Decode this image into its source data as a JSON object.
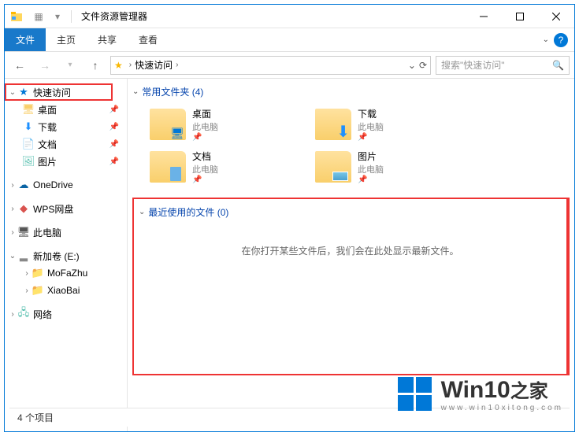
{
  "title": "文件资源管理器",
  "ribbon": {
    "file": "文件",
    "home": "主页",
    "share": "共享",
    "view": "查看"
  },
  "address": {
    "location": "快速访问",
    "search_placeholder": "搜索\"快速访问\""
  },
  "sidebar": {
    "quick": "快速访问",
    "desktop": "桌面",
    "downloads": "下载",
    "documents": "文档",
    "pictures": "图片",
    "onedrive": "OneDrive",
    "wps": "WPS网盘",
    "thispc": "此电脑",
    "volume": "新加卷 (E:)",
    "mofazhu": "MoFaZhu",
    "xiaobai": "XiaoBai",
    "network": "网络"
  },
  "groups": {
    "frequent": "常用文件夹 (4)",
    "recent": "最近使用的文件 (0)",
    "recent_empty": "在你打开某些文件后，我们会在此处显示最新文件。"
  },
  "folders": {
    "desktop": {
      "name": "桌面",
      "loc": "此电脑"
    },
    "downloads": {
      "name": "下载",
      "loc": "此电脑"
    },
    "documents": {
      "name": "文档",
      "loc": "此电脑"
    },
    "pictures": {
      "name": "图片",
      "loc": "此电脑"
    }
  },
  "status": "4 个项目",
  "watermark": {
    "brand": "Win10",
    "suffix": "之家",
    "url": "www.win10xitong.com"
  }
}
